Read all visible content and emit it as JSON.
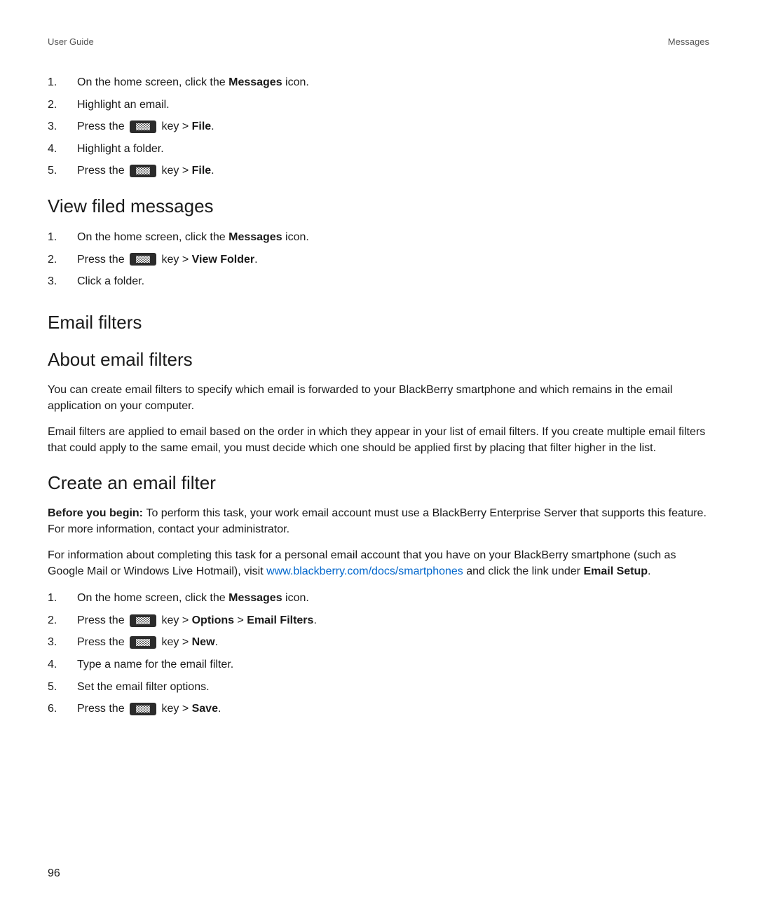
{
  "header": {
    "left": "User Guide",
    "right": "Messages"
  },
  "section_file": {
    "steps": [
      {
        "prefix": "On the home screen, click the ",
        "bold": "Messages",
        "suffix": " icon."
      },
      {
        "text": "Highlight an email."
      },
      {
        "prefix": "Press the ",
        "key": true,
        "mid": " key > ",
        "bold": "File",
        "suffix": "."
      },
      {
        "text": "Highlight a folder."
      },
      {
        "prefix": "Press the ",
        "key": true,
        "mid": " key > ",
        "bold": "File",
        "suffix": "."
      }
    ]
  },
  "section_view": {
    "title": "View filed messages",
    "steps": [
      {
        "prefix": "On the home screen, click the ",
        "bold": "Messages",
        "suffix": " icon."
      },
      {
        "prefix": "Press the ",
        "key": true,
        "mid": " key > ",
        "bold": "View Folder",
        "suffix": "."
      },
      {
        "text": "Click a folder."
      }
    ]
  },
  "section_email_filters": {
    "title": "Email filters"
  },
  "section_about": {
    "title": "About email filters",
    "p1": "You can create email filters to specify which email is forwarded to your BlackBerry smartphone and which remains in the email application on your computer.",
    "p2": "Email filters are applied to email based on the order in which they appear in your list of email filters. If you create multiple email filters that could apply to the same email, you must decide which one should be applied first by placing that filter higher in the list."
  },
  "section_create": {
    "title": "Create an email filter",
    "before_label": "Before you begin: ",
    "before_text": "To perform this task, your work email account must use a BlackBerry Enterprise Server that supports this feature. For more information, contact your administrator.",
    "p2_prefix": "For information about completing this task for a personal email account that you have on your BlackBerry smartphone (such as Google Mail or Windows Live Hotmail), visit ",
    "p2_link": "www.blackberry.com/docs/smartphones",
    "p2_mid": " and click the link under ",
    "p2_bold": "Email Setup",
    "p2_suffix": ".",
    "steps": [
      {
        "prefix": "On the home screen, click the ",
        "bold": "Messages",
        "suffix": " icon."
      },
      {
        "prefix": "Press the ",
        "key": true,
        "mid": " key > ",
        "bold": "Options",
        "mid2": " > ",
        "bold2": "Email Filters",
        "suffix": "."
      },
      {
        "prefix": "Press the ",
        "key": true,
        "mid": " key > ",
        "bold": "New",
        "suffix": "."
      },
      {
        "text": "Type a name for the email filter."
      },
      {
        "text": "Set the email filter options."
      },
      {
        "prefix": "Press the ",
        "key": true,
        "mid": " key > ",
        "bold": "Save",
        "suffix": "."
      }
    ]
  },
  "page_number": "96"
}
